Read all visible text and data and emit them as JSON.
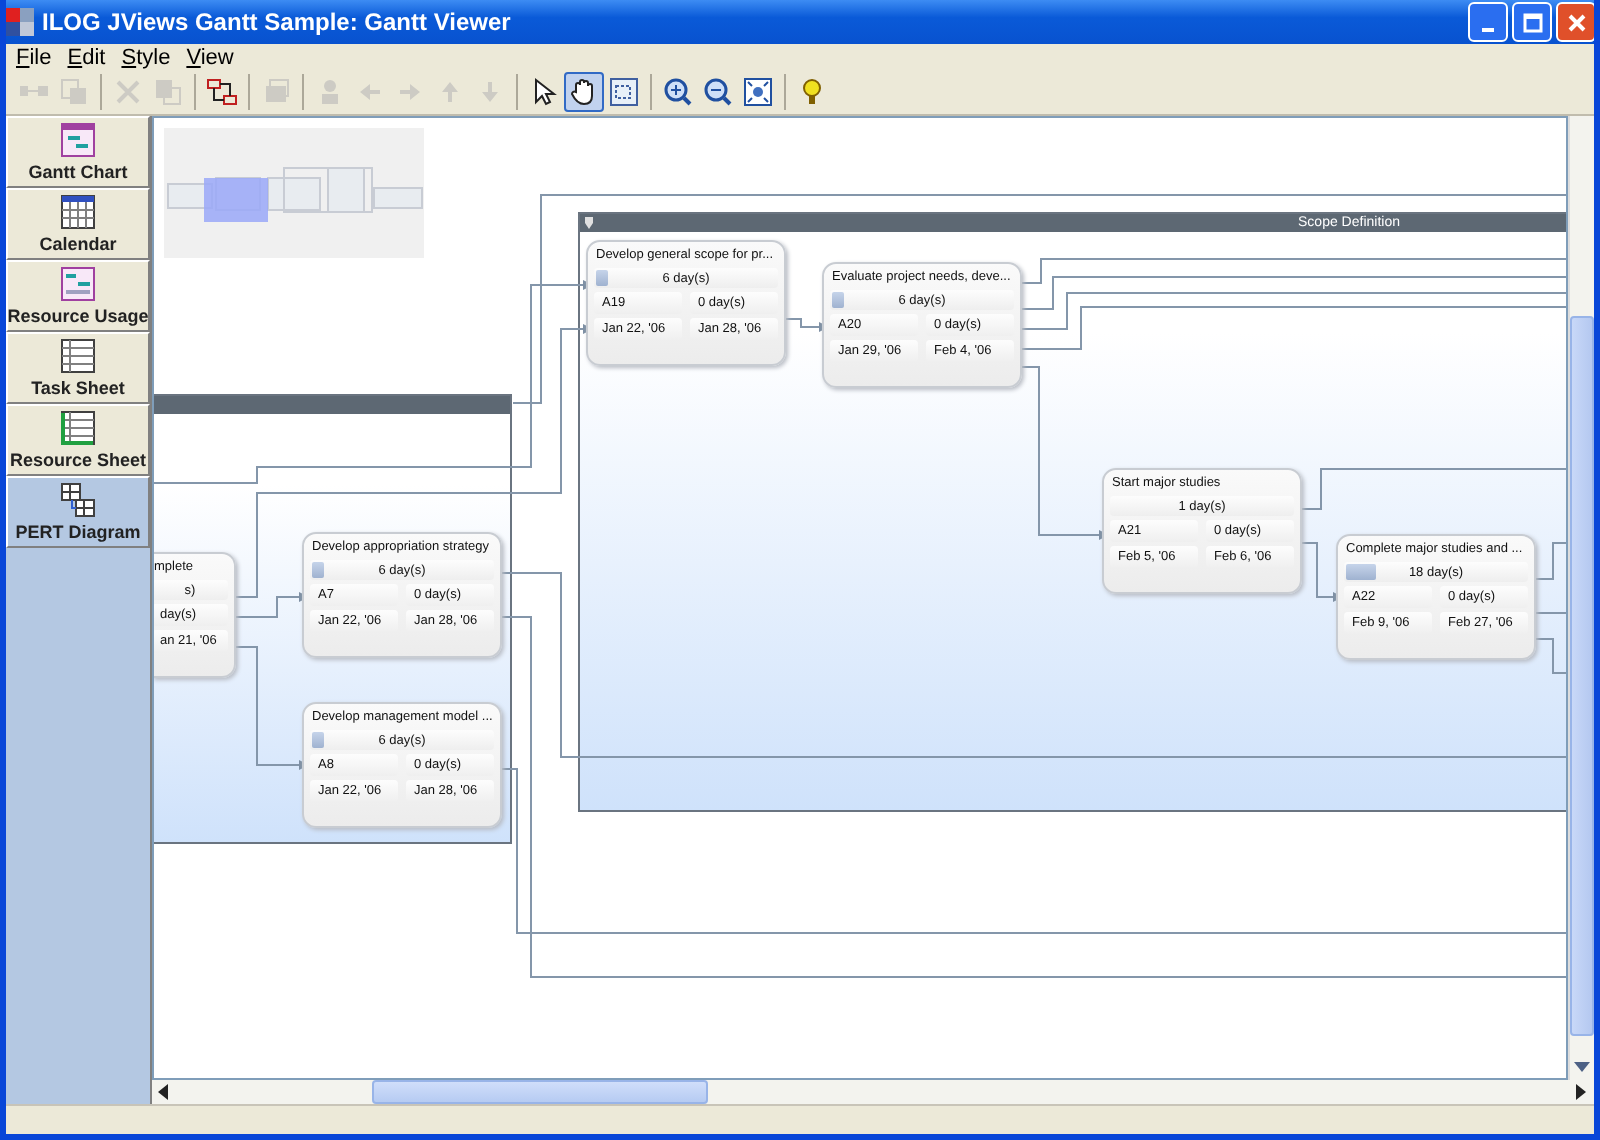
{
  "window": {
    "title": "ILOG JViews Gantt Sample: Gantt Viewer"
  },
  "menu": [
    {
      "label": "File"
    },
    {
      "label": "Edit"
    },
    {
      "label": "Style"
    },
    {
      "label": "View"
    }
  ],
  "toolbar": {
    "groups": [
      [
        {
          "disabled": true,
          "selected": false
        },
        {
          "disabled": true,
          "selected": false
        }
      ],
      [
        {
          "disabled": true,
          "selected": false
        },
        {
          "disabled": true,
          "selected": false
        }
      ],
      [
        {
          "disabled": false,
          "selected": false
        }
      ],
      [
        {
          "disabled": true,
          "selected": false
        }
      ],
      [
        {
          "disabled": true,
          "selected": false
        },
        {
          "disabled": true,
          "selected": false
        },
        {
          "disabled": true,
          "selected": false
        },
        {
          "disabled": true,
          "selected": false
        },
        {
          "disabled": true,
          "selected": false
        }
      ],
      [
        {
          "disabled": false,
          "selected": false
        },
        {
          "disabled": false,
          "selected": true
        },
        {
          "disabled": false,
          "selected": false
        }
      ],
      [
        {
          "disabled": false,
          "selected": false
        },
        {
          "disabled": false,
          "selected": false
        },
        {
          "disabled": false,
          "selected": false
        }
      ],
      [
        {
          "disabled": false,
          "selected": false
        }
      ]
    ]
  },
  "sidebar": {
    "items": [
      {
        "label": "Gantt Chart",
        "selected": false
      },
      {
        "label": "Calendar",
        "selected": false
      },
      {
        "label": "Resource Usage",
        "selected": false
      },
      {
        "label": "Task Sheet",
        "selected": false
      },
      {
        "label": "Resource Sheet",
        "selected": false
      },
      {
        "label": "PERT Diagram",
        "selected": true
      }
    ]
  },
  "pert": {
    "groups": [
      {
        "title": "Scope Definition"
      }
    ],
    "nodes": [
      {
        "kind": "clipped",
        "title": "mplete",
        "duration": "s)",
        "slack": "day(s)",
        "finish": "an 21, '06"
      },
      {
        "kind": "full",
        "title": "Develop appropriation strategy",
        "duration": "6 day(s)",
        "level": 0.06,
        "id": "A7",
        "slack": "0 day(s)",
        "start": "Jan 22, '06",
        "finish": "Jan 28, '06"
      },
      {
        "kind": "full",
        "title": "Develop management model ...",
        "duration": "6 day(s)",
        "level": 0.06,
        "id": "A8",
        "slack": "0 day(s)",
        "start": "Jan 22, '06",
        "finish": "Jan 28, '06"
      },
      {
        "kind": "full",
        "title": "Develop general scope for pr...",
        "duration": "6 day(s)",
        "level": 0.06,
        "id": "A19",
        "slack": "0 day(s)",
        "start": "Jan 22, '06",
        "finish": "Jan 28, '06"
      },
      {
        "kind": "full",
        "title": "Evaluate project needs, deve...",
        "duration": "6 day(s)",
        "level": 0.06,
        "id": "A20",
        "slack": "0 day(s)",
        "start": "Jan 29, '06",
        "finish": "Feb 4, '06"
      },
      {
        "kind": "full",
        "title": "Start major studies",
        "duration": "1 day(s)",
        "id": "A21",
        "slack": "0 day(s)",
        "start": "Feb 5, '06",
        "finish": "Feb 6, '06"
      },
      {
        "kind": "full",
        "title": "Complete major studies and ...",
        "duration": "18 day(s)",
        "level": 0.16,
        "id": "A22",
        "slack": "0 day(s)",
        "start": "Feb 9, '06",
        "finish": "Feb 27, '06"
      }
    ]
  }
}
